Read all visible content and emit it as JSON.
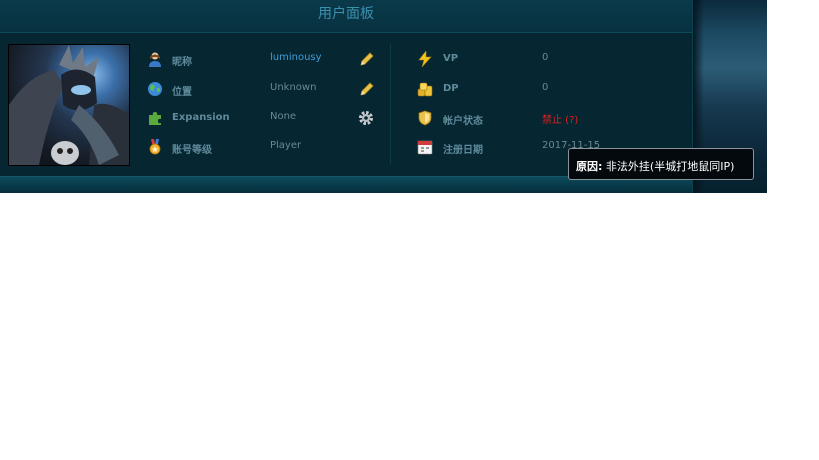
{
  "panel": {
    "title": "用户面板"
  },
  "left_rows": [
    {
      "icon": "user-icon",
      "label": "昵称",
      "value": "luminousy",
      "action": "pencil-icon"
    },
    {
      "icon": "globe-icon",
      "label": "位置",
      "value": "Unknown",
      "action": "pencil-icon"
    },
    {
      "icon": "puzzle-icon",
      "label": "Expansion",
      "value": "None",
      "action": "gear-icon"
    },
    {
      "icon": "medal-icon",
      "label": "账号等级",
      "value": "Player"
    }
  ],
  "right_rows": [
    {
      "icon": "lightning-icon",
      "label": "VP",
      "value": "0"
    },
    {
      "icon": "coins-icon",
      "label": "DP",
      "value": "0"
    },
    {
      "icon": "shield-icon",
      "label": "帐户状态",
      "value": "禁止 (?)"
    },
    {
      "icon": "calendar-icon",
      "label": "注册日期",
      "value": "2017-11-15"
    }
  ],
  "tooltip": {
    "prefix": "原因:",
    "text": "非法外挂(半城打地鼠同IP)"
  },
  "colors": {
    "ban": "#e2201b",
    "link": "#3f9ed6",
    "panel": "#062632"
  }
}
